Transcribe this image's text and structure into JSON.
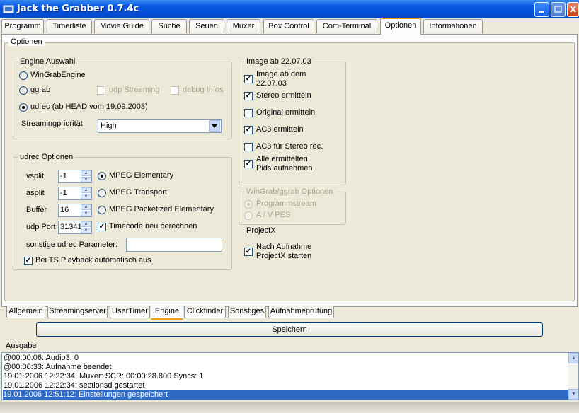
{
  "window": {
    "title": "Jack the Grabber 0.7.4c"
  },
  "main_tabs": [
    {
      "label": "Programm"
    },
    {
      "label": "Timerliste"
    },
    {
      "label": "Movie Guide"
    },
    {
      "label": "Suche"
    },
    {
      "label": "Serien"
    },
    {
      "label": "Muxer"
    },
    {
      "label": "Box Control"
    },
    {
      "label": "Com-Terminal"
    },
    {
      "label": "Optionen"
    },
    {
      "label": "Informationen"
    }
  ],
  "options_title": "Optionen",
  "engine": {
    "title": "Engine Auswahl",
    "wingrab": "WinGrabEngine",
    "ggrab": "ggrab",
    "udp_streaming": "udp Streaming",
    "debug_infos": "debug Infos",
    "udrec": "udrec (ab HEAD vom 19.09.2003)",
    "prio_label": "Streamingpriorität",
    "prio_value": "High"
  },
  "udrec": {
    "title": "udrec Optionen",
    "vsplit_label": "vsplit",
    "vsplit_value": "-1",
    "asplit_label": "asplit",
    "asplit_value": "-1",
    "buffer_label": "Buffer",
    "buffer_value": "16",
    "port_label": "udp Port",
    "port_value": "31341",
    "mpeg_elementary": "MPEG Elementary",
    "mpeg_transport": "MPEG Transport",
    "mpeg_pes": "MPEG Packetized Elementary",
    "timecode": "Timecode neu berechnen",
    "sonstige": "sonstige udrec Parameter:",
    "ts_playback": "Bei TS Playback automatisch aus"
  },
  "image": {
    "title": "Image ab 22.07.03",
    "image_ab_1": "Image ab dem",
    "image_ab_2": "22.07.03",
    "stereo": "Stereo ermitteln",
    "original": "Original ermitteln",
    "ac3": "AC3 ermitteln",
    "ac3_stereo": "AC3 für Stereo rec.",
    "alle_1": "Alle ermittelten",
    "alle_2": "Pids aufnehmen"
  },
  "wingrab": {
    "title": "WinGrab/ggrab Optionen",
    "programmstream": "Programmstream",
    "av_pes": "A / V PES"
  },
  "projectx": {
    "title": "ProjectX",
    "nach_1": "Nach Aufnahme",
    "nach_2": "ProjectX starten"
  },
  "sub_tabs": [
    {
      "label": "Allgemein"
    },
    {
      "label": "Streamingserver"
    },
    {
      "label": "UserTimer"
    },
    {
      "label": "Engine"
    },
    {
      "label": "Clickfinder"
    },
    {
      "label": "Sonstiges"
    },
    {
      "label": "Aufnahmeprüfung"
    }
  ],
  "save_label": "Speichern",
  "ausgabe_label": "Ausgabe",
  "output_lines": [
    "@00:00:06: Audio3: 0",
    "@00:00:33: Aufnahme beendet",
    "19.01.2006 12:22:34: Muxer: SCR: 00:00:28.800 Syncs: 1",
    "19.01.2006 12:22:34: sectionsd gestartet",
    "19.01.2006 12:51:12: Einstellungen gespeichert"
  ],
  "colors": {
    "titlebar": "#0a5ce4",
    "selection": "#316ac5",
    "active_tab_accent": "#f0a020"
  }
}
